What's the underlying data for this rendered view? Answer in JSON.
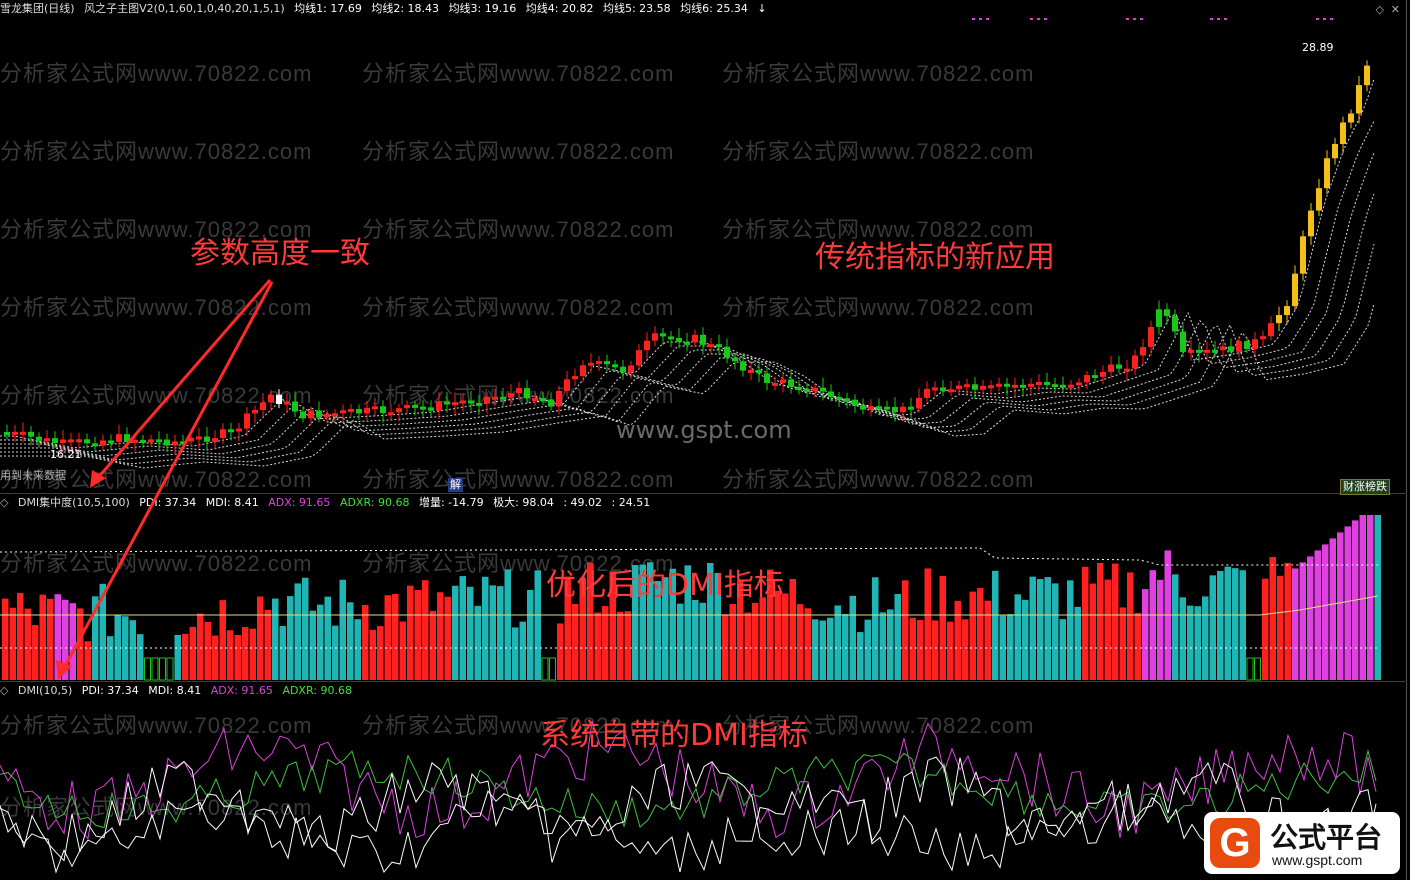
{
  "top_header": {
    "stock": "雪龙集团(日线)",
    "indicator": "风之子主图V2(0,1,60,1,0,40,20,1,5,1)",
    "ma1": "均线1: 17.69",
    "ma2": "均线2: 18.43",
    "ma3": "均线3: 19.16",
    "ma4": "均线4: 20.82",
    "ma5": "均线5: 23.58",
    "ma6": "均线6: 25.34"
  },
  "price_high": "28.89",
  "price_low": "16.21",
  "future_data_note": "用到未来数据",
  "jie_label": "解",
  "tab_label": "财涨榜跌",
  "dmi_header": {
    "name": "DMI集中度(10,5,100)",
    "pdi": "PDI: 37.34",
    "mdi": "MDI: 8.41",
    "adx": "ADX: 91.65",
    "adxr": "ADXR: 90.68",
    "zl": "增量: -14.79",
    "jd": "极大: 98.04",
    "v1": ": 49.02",
    "v2": ": 24.51"
  },
  "sys_header": {
    "name": "DMI(10,5)",
    "pdi": "PDI: 37.34",
    "mdi": "MDI: 8.41",
    "adx": "ADX: 91.65",
    "adxr": "ADXR: 90.68"
  },
  "annotations": {
    "param": "参数高度一致",
    "traditional": "传统指标的新应用",
    "optimized": "优化后的DMI指标",
    "system": "系统自带的DMI指标"
  },
  "watermark": "分析家公式网www.70822.com",
  "site": "www.gspt.com",
  "logo": {
    "title": "公式平台",
    "url": "www.gspt.com"
  },
  "colors": {
    "up": "#ff2020",
    "down": "#18c818",
    "cyan": "#1fb5b5",
    "magenta": "#e040e0",
    "yellow": "#f2c018"
  }
}
